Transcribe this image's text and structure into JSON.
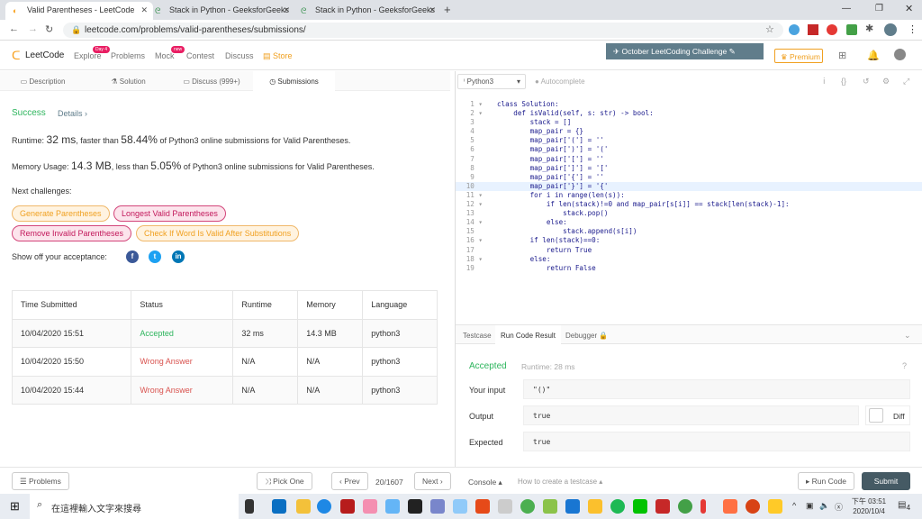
{
  "browser": {
    "tabs": [
      {
        "title": "Valid Parentheses - LeetCode",
        "active": true
      },
      {
        "title": "Stack in Python - GeeksforGeeks"
      },
      {
        "title": "Stack in Python - GeeksforGeeks"
      }
    ],
    "url": "leetcode.com/problems/valid-parentheses/submissions/"
  },
  "nav": {
    "logo": "LeetCode",
    "items": [
      "Explore",
      "Problems",
      "Mock",
      "Contest",
      "Discuss",
      "Store"
    ],
    "explore_badge": "Day 4",
    "mock_badge": "new",
    "challenge": "October LeetCoding Challenge",
    "premium": "Premium"
  },
  "panel_tabs": [
    "Description",
    "Solution",
    "Discuss (999+)",
    "Submissions"
  ],
  "result": {
    "status": "Success",
    "details": "Details",
    "runtime_prefix": "Runtime:",
    "runtime": "32 ms",
    "runtime_mid": ", faster than",
    "runtime_pct": "58.44%",
    "runtime_suffix": "of Python3 online submissions for Valid Parentheses.",
    "memory_prefix": "Memory Usage:",
    "memory": "14.3 MB",
    "memory_mid": ", less than",
    "memory_pct": "5.05%",
    "memory_suffix": "of Python3 online submissions for Valid Parentheses.",
    "next": "Next challenges:",
    "challenges": [
      "Generate Parentheses",
      "Longest Valid Parentheses",
      "Remove Invalid Parentheses",
      "Check If Word Is Valid After Substitutions"
    ],
    "share": "Show off your acceptance:"
  },
  "table": {
    "headers": [
      "Time Submitted",
      "Status",
      "Runtime",
      "Memory",
      "Language"
    ],
    "rows": [
      [
        "10/04/2020 15:51",
        "Accepted",
        "32 ms",
        "14.3 MB",
        "python3"
      ],
      [
        "10/04/2020 15:50",
        "Wrong Answer",
        "N/A",
        "N/A",
        "python3"
      ],
      [
        "10/04/2020 15:44",
        "Wrong Answer",
        "N/A",
        "N/A",
        "python3"
      ]
    ]
  },
  "editor": {
    "language": "Python3",
    "autocomplete": "Autocomplete",
    "code": [
      "class Solution:",
      "    def isValid(self, s: str) -> bool:",
      "        stack = []",
      "        map_pair = {}",
      "        map_pair['('] = ''",
      "        map_pair[')'] = '('",
      "        map_pair['['] = ''",
      "        map_pair[']'] = '['",
      "        map_pair['{'] = ''",
      "        map_pair['}'] = '{'",
      "        for i in range(len(s)):",
      "            if len(stack)!=0 and map_pair[s[i]] == stack[len(stack)-1]:",
      "                stack.pop()",
      "            else:",
      "                stack.append(s[i])",
      "        if len(stack)==0:",
      "            return True",
      "        else:",
      "            return False"
    ]
  },
  "console": {
    "tabs": [
      "Testcase",
      "Run Code Result",
      "Debugger"
    ],
    "status": "Accepted",
    "runtime": "Runtime: 28 ms",
    "input_label": "Your input",
    "input": "\"()\"",
    "output_label": "Output",
    "output": "true",
    "expected_label": "Expected",
    "expected": "true",
    "diff": "Diff"
  },
  "bottom": {
    "problems": "Problems",
    "pick": "Pick One",
    "prev": "Prev",
    "page": "20/1607",
    "next": "Next",
    "console": "Console",
    "how": "How to create a testcase",
    "run": "Run Code",
    "submit": "Submit"
  },
  "taskbar": {
    "search": "在這裡輸入文字來搜尋",
    "time": "下午 03:51",
    "date": "2020/10/4",
    "notif": "4"
  },
  "colors": {
    "success": "#2db55d",
    "error": "#d9534f",
    "accent": "#455a64",
    "orange": "#f0a020"
  }
}
